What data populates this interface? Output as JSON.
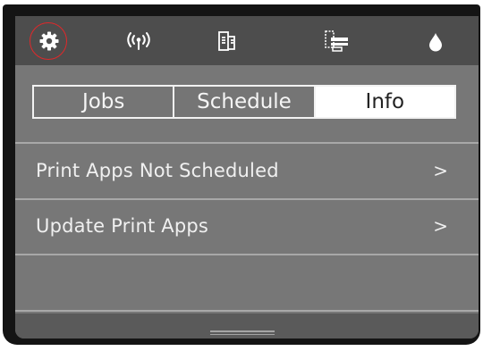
{
  "topbar": {
    "icons": [
      {
        "name": "settings-gear-icon",
        "highlighted": true
      },
      {
        "name": "wireless-signal-icon"
      },
      {
        "name": "wifi-direct-print-icon"
      },
      {
        "name": "printer-status-icon"
      },
      {
        "name": "ink-drop-icon"
      }
    ]
  },
  "tabs": [
    {
      "label": "Jobs",
      "active": false
    },
    {
      "label": "Schedule",
      "active": false
    },
    {
      "label": "Info",
      "active": true
    }
  ],
  "list": {
    "items": [
      {
        "label": "Print Apps Not Scheduled",
        "chevron": ">"
      },
      {
        "label": "Update Print Apps",
        "chevron": ">"
      }
    ]
  },
  "colors": {
    "panel": "#777777",
    "topbar": "#4d4d4d",
    "highlight": "#e0282a",
    "active_tab": "#ffffff"
  }
}
